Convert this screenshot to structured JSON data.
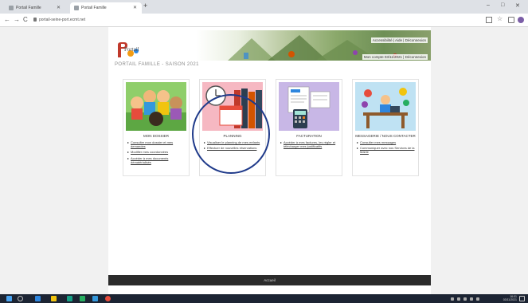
{
  "browser": {
    "tabs": [
      {
        "label": "Portail Famille"
      },
      {
        "label": "Portail Famille"
      }
    ],
    "new_tab": "+",
    "url": "portail-seine-port.ecmt.net",
    "window_controls": {
      "minimize": "–",
      "maximize": "□",
      "close": "✕"
    },
    "nav": {
      "back": "←",
      "forward": "→",
      "reload": "C"
    }
  },
  "header": {
    "logo_text": "Portail",
    "user_links": "Accessibilité | Aide | Déconnexion",
    "date_line": "Mon compte 03/11/2021 | Déconnexion"
  },
  "page_title": "PORTAIL FAMILLE - SAISON 2021",
  "cards": [
    {
      "title": "MON DOSSIER",
      "items": [
        "Consulter mon dossier et mes demandes",
        "Modifier mes coordonnées",
        "Accéder à mes documents dématérialisés"
      ]
    },
    {
      "title": "PLANNING",
      "items": [
        "Visualiser le planning de mes enfants",
        "Effectuer de nouvelles réservations"
      ]
    },
    {
      "title": "FACTURATION",
      "items": [
        "Accéder à mes factures, les régler et télécharger mes justificatifs"
      ]
    },
    {
      "title": "MESSAGERIE / NOUS CONTACTER",
      "items": [
        "Consulter mes messages",
        "Communiquer avec nos Services de la Mairie"
      ]
    }
  ],
  "footer": {
    "text": "Accueil"
  },
  "taskbar": {
    "clock_time": "16:01",
    "clock_date": "03/11/2021"
  },
  "colors": {
    "annotation_circle": "#1f3a8a",
    "footer_bg": "#2b2b2b",
    "taskbar_bg": "#1c2433"
  }
}
